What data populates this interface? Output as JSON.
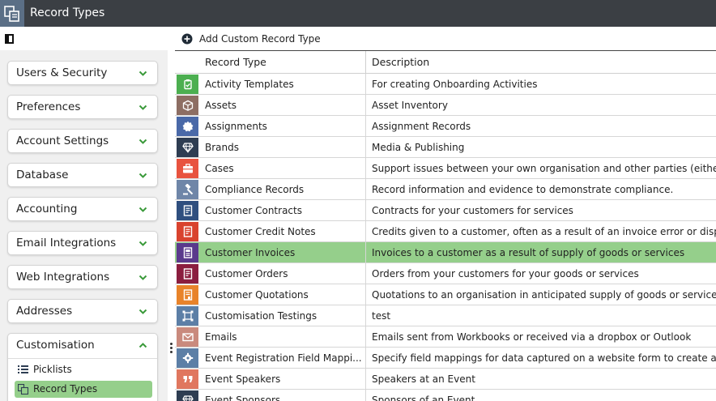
{
  "app": {
    "title": "Record Types"
  },
  "toolbar": {
    "add_label": "Add Custom Record Type"
  },
  "sidebar": {
    "sections": [
      {
        "label": "Users & Security"
      },
      {
        "label": "Preferences"
      },
      {
        "label": "Account Settings"
      },
      {
        "label": "Database"
      },
      {
        "label": "Accounting"
      },
      {
        "label": "Email Integrations"
      },
      {
        "label": "Web Integrations"
      },
      {
        "label": "Addresses"
      },
      {
        "label": "Customisation",
        "expanded": true,
        "items": [
          {
            "label": "Picklists",
            "icon": "list-icon"
          },
          {
            "label": "Record Types",
            "icon": "record-types-icon",
            "active": true
          }
        ]
      }
    ]
  },
  "table": {
    "columns": [
      "Record Type",
      "Description"
    ],
    "rows": [
      {
        "name": "Activity Templates",
        "description": "For creating Onboarding Activities",
        "color": "#4caf50",
        "icon": "clipboard-icon"
      },
      {
        "name": "Assets",
        "description": "Asset Inventory",
        "color": "#8d6e63",
        "icon": "box-icon"
      },
      {
        "name": "Assignments",
        "description": "Assignment Records",
        "color": "#4a69a8",
        "icon": "badge-icon"
      },
      {
        "name": "Brands",
        "description": "Media & Publishing",
        "color": "#2e3d52",
        "icon": "diamond-icon"
      },
      {
        "name": "Cases",
        "description": "Support issues between your own organisation and other parties (either",
        "color": "#e8533f",
        "icon": "briefcase-icon"
      },
      {
        "name": "Compliance Records",
        "description": "Record information and evidence to demonstrate compliance.",
        "color": "#6f86a8",
        "icon": "gavel-icon"
      },
      {
        "name": "Customer Contracts",
        "description": "Contracts for your customers for services",
        "color": "#2f4f7f",
        "icon": "document-icon"
      },
      {
        "name": "Customer Credit Notes",
        "description": "Credits given to a customer, often as a result of an invoice error or dispu",
        "color": "#d9432e",
        "icon": "document-icon"
      },
      {
        "name": "Customer Invoices",
        "description": "Invoices to a customer as a result of supply of goods or services",
        "color": "#5a3a8c",
        "icon": "invoice-icon",
        "selected": true
      },
      {
        "name": "Customer Orders",
        "description": "Orders from your customers for your goods or services",
        "color": "#8b1e3f",
        "icon": "document-icon"
      },
      {
        "name": "Customer Quotations",
        "description": "Quotations to an organisation in anticipated supply of goods or services",
        "color": "#e8832a",
        "icon": "quote-doc-icon"
      },
      {
        "name": "Customisation Testings",
        "description": "test",
        "color": "#5c7fa6",
        "icon": "frame-icon"
      },
      {
        "name": "Emails",
        "description": "Emails sent from Workbooks or received via a dropbox or Outlook",
        "color": "#c98a7d",
        "icon": "envelope-icon"
      },
      {
        "name": "Event Registration Field Mappi...",
        "description": "Specify field mappings for data captured on a website form to create an",
        "color": "#5c7fa6",
        "icon": "gear-icon"
      },
      {
        "name": "Event Speakers",
        "description": "Speakers at an Event",
        "color": "#e0775f",
        "icon": "quote-icon"
      },
      {
        "name": "Event Sponsors",
        "description": "Sponsors of an Event",
        "color": "#2e3d52",
        "icon": "diamond-icon"
      }
    ]
  }
}
